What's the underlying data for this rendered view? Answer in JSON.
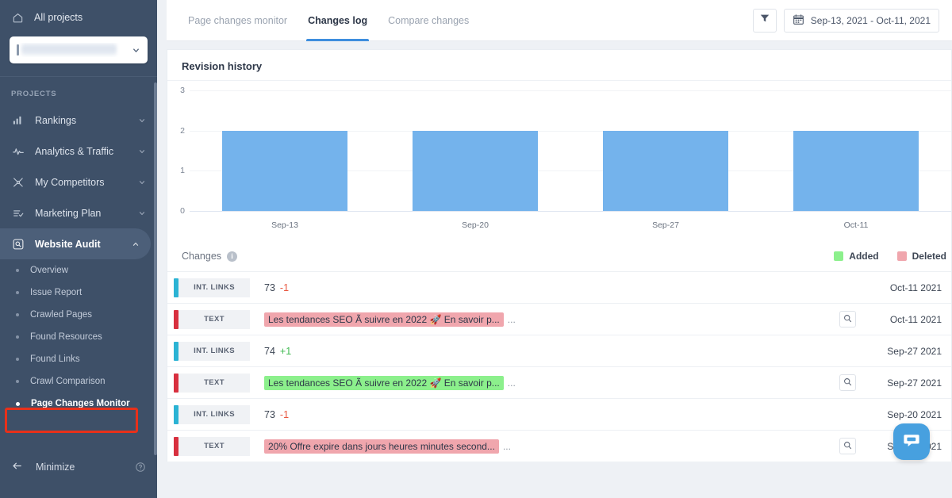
{
  "sidebar": {
    "all_projects_label": "All projects",
    "project_selector_value": "",
    "section_label": "PROJECTS",
    "items": [
      {
        "label": "Rankings",
        "icon": "bar-chart-icon",
        "expandable": true
      },
      {
        "label": "Analytics & Traffic",
        "icon": "activity-pulse-icon",
        "expandable": true
      },
      {
        "label": "My Competitors",
        "icon": "competitors-icon",
        "expandable": true
      },
      {
        "label": "Marketing Plan",
        "icon": "checklist-icon",
        "expandable": true
      },
      {
        "label": "Website Audit",
        "icon": "audit-magnifier-icon",
        "expandable": true,
        "active": true
      }
    ],
    "subitems": [
      {
        "label": "Overview"
      },
      {
        "label": "Issue Report"
      },
      {
        "label": "Crawled Pages"
      },
      {
        "label": "Found Resources"
      },
      {
        "label": "Found Links"
      },
      {
        "label": "Crawl Comparison"
      },
      {
        "label": "Page Changes Monitor",
        "current": true
      }
    ],
    "minimize_label": "Minimize",
    "highlight_color": "#e8301a"
  },
  "header": {
    "tabs": [
      {
        "label": "Page changes monitor",
        "active": false
      },
      {
        "label": "Changes log",
        "active": true
      },
      {
        "label": "Compare changes",
        "active": false
      }
    ],
    "filter_icon": "filter-funnel-icon",
    "calendar_icon": "calendar-icon",
    "date_range": "Sep-13, 2021 - Oct-11, 2021"
  },
  "chart_card": {
    "title": "Revision history"
  },
  "chart_data": {
    "type": "bar",
    "title": "Revision history",
    "categories": [
      "Sep-13",
      "Sep-20",
      "Sep-27",
      "Oct-11"
    ],
    "values": [
      2,
      2,
      2,
      2
    ],
    "xlabel": "",
    "ylabel": "",
    "ylim": [
      0,
      3
    ],
    "yticks": [
      0,
      1,
      2,
      3
    ],
    "grid": true,
    "legend": "none",
    "bar_color": "#74b3ec"
  },
  "changes": {
    "title": "Changes",
    "info_icon": "info-icon",
    "legend": [
      {
        "label": "Added",
        "color": "#8cf08c"
      },
      {
        "label": "Deleted",
        "color": "#f0a6ad"
      }
    ],
    "rows": [
      {
        "tag": "INT. LINKS",
        "tag_color": "#2bb3d4",
        "kind": "count",
        "count": "73",
        "delta": "-1",
        "delta_sign": "neg",
        "has_search": false,
        "date": "Oct-11 2021"
      },
      {
        "tag": "TEXT",
        "tag_color": "#d8303f",
        "kind": "text",
        "text": "Les tendances SEO Ã suivre en 2022 🚀 En savoir p...",
        "highlight": "deleted",
        "trailing": "...",
        "has_search": true,
        "date": "Oct-11 2021"
      },
      {
        "tag": "INT. LINKS",
        "tag_color": "#2bb3d4",
        "kind": "count",
        "count": "74",
        "delta": "+1",
        "delta_sign": "pos",
        "has_search": false,
        "date": "Sep-27 2021"
      },
      {
        "tag": "TEXT",
        "tag_color": "#d8303f",
        "kind": "text",
        "text": "Les tendances SEO Ã suivre en 2022 🚀 En savoir p...",
        "highlight": "added",
        "trailing": "...",
        "has_search": true,
        "date": "Sep-27 2021"
      },
      {
        "tag": "INT. LINKS",
        "tag_color": "#2bb3d4",
        "kind": "count",
        "count": "73",
        "delta": "-1",
        "delta_sign": "neg",
        "has_search": false,
        "date": "Sep-20 2021"
      },
      {
        "tag": "TEXT",
        "tag_color": "#d8303f",
        "kind": "text",
        "text": "20% Offre expire dans jours heures minutes second...",
        "highlight": "deleted",
        "trailing": "...",
        "has_search": true,
        "date": "Sep-20 2021"
      }
    ]
  },
  "chat": {
    "icon": "chat-bubble-icon",
    "color": "#47a0df"
  }
}
